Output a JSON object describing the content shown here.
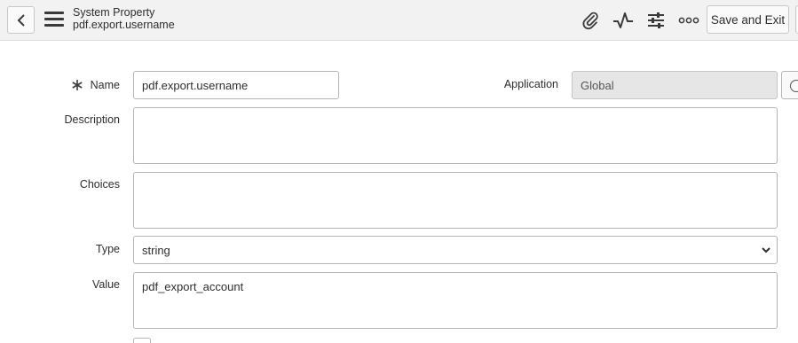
{
  "header": {
    "title": "System Property",
    "subtitle": "pdf.export.username",
    "save_exit_label": "Save and Exit",
    "icons": [
      "back-icon",
      "menu-icon",
      "attachment-icon",
      "activity-icon",
      "settings-sliders-icon",
      "more-icon"
    ]
  },
  "form": {
    "name": {
      "label": "Name",
      "value": "pdf.export.username",
      "mandatory": true
    },
    "application": {
      "label": "Application",
      "value": "Global"
    },
    "description": {
      "label": "Description",
      "value": ""
    },
    "choices": {
      "label": "Choices",
      "value": ""
    },
    "type": {
      "label": "Type",
      "value": "string"
    },
    "value": {
      "label": "Value",
      "value": "pdf_export_account"
    }
  },
  "colors": {
    "header_bg": "#f2f2f2",
    "readonly_bg": "#e6e6e6",
    "border": "#b4b4b4",
    "text": "#2e2e2e"
  }
}
